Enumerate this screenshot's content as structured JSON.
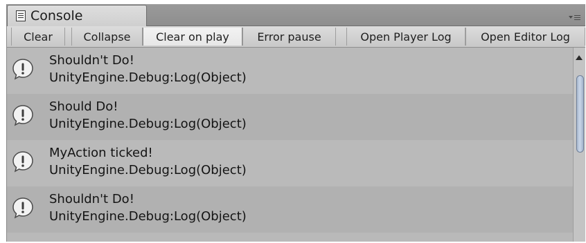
{
  "window": {
    "title": "Console"
  },
  "toolbar": {
    "buttons": [
      {
        "label": "Clear"
      },
      {
        "label": "Collapse"
      },
      {
        "label": "Clear on play"
      },
      {
        "label": "Error pause"
      },
      {
        "label": "Open Player Log"
      },
      {
        "label": "Open Editor Log"
      }
    ],
    "active_button": "Clear on play"
  },
  "logs": [
    {
      "message": "Shouldn't Do!",
      "trace": "UnityEngine.Debug:Log(Object)",
      "icon": "info-icon"
    },
    {
      "message": "Should Do!",
      "trace": "UnityEngine.Debug:Log(Object)",
      "icon": "info-icon"
    },
    {
      "message": "MyAction ticked!",
      "trace": "UnityEngine.Debug:Log(Object)",
      "icon": "info-icon"
    },
    {
      "message": "Shouldn't Do!",
      "trace": "UnityEngine.Debug:Log(Object)",
      "icon": "info-icon"
    }
  ],
  "colors": {
    "panel_bg": "#b9b9b9",
    "row_alt": "#b1b1b1",
    "scroll_thumb": "#b9c8de"
  }
}
